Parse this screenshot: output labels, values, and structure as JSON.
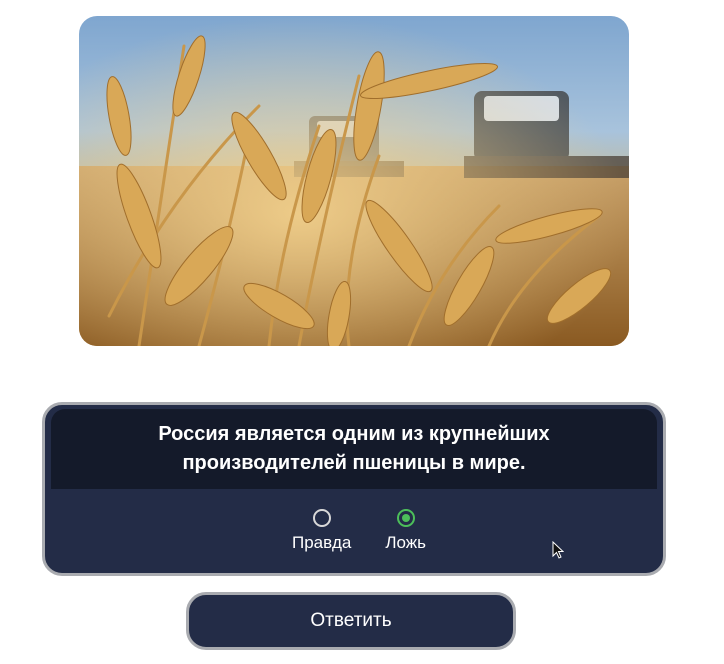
{
  "photo": {
    "icon": "wheat-field-photo"
  },
  "question": {
    "text": "Россия является одним из крупнейших производителей пшеницы в мире."
  },
  "options": [
    {
      "label": "Правда",
      "selected": false
    },
    {
      "label": "Ложь",
      "selected": true
    }
  ],
  "submit": {
    "label": "Ответить"
  },
  "colors": {
    "card_bg": "#232c47",
    "header_bg": "#141a2a",
    "border": "#a9abb0",
    "selected_radio": "#4cbf5a"
  }
}
